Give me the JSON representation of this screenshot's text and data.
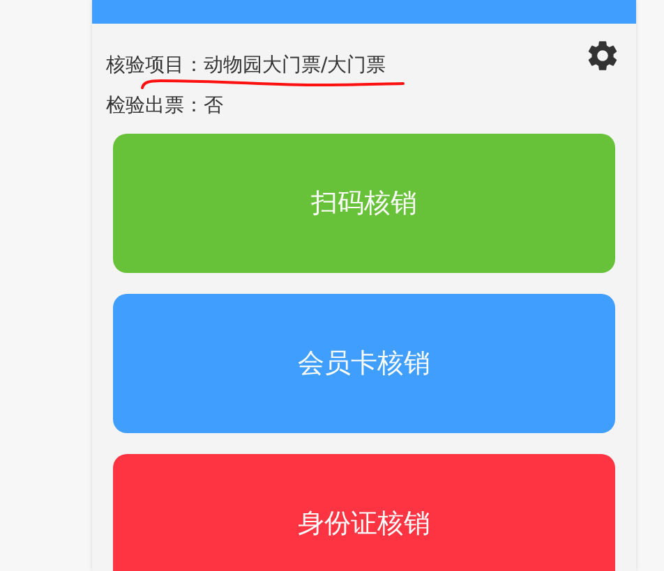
{
  "info": [
    {
      "label": "核验项目：",
      "value": "动物园大门票/大门票"
    },
    {
      "label": "检验出票：",
      "value": "否"
    }
  ],
  "buttons": [
    {
      "label": "扫码核销",
      "color": "#67c23a"
    },
    {
      "label": "会员卡核销",
      "color": "#409eff"
    },
    {
      "label": "身份证核销",
      "color": "#ff3442"
    }
  ]
}
